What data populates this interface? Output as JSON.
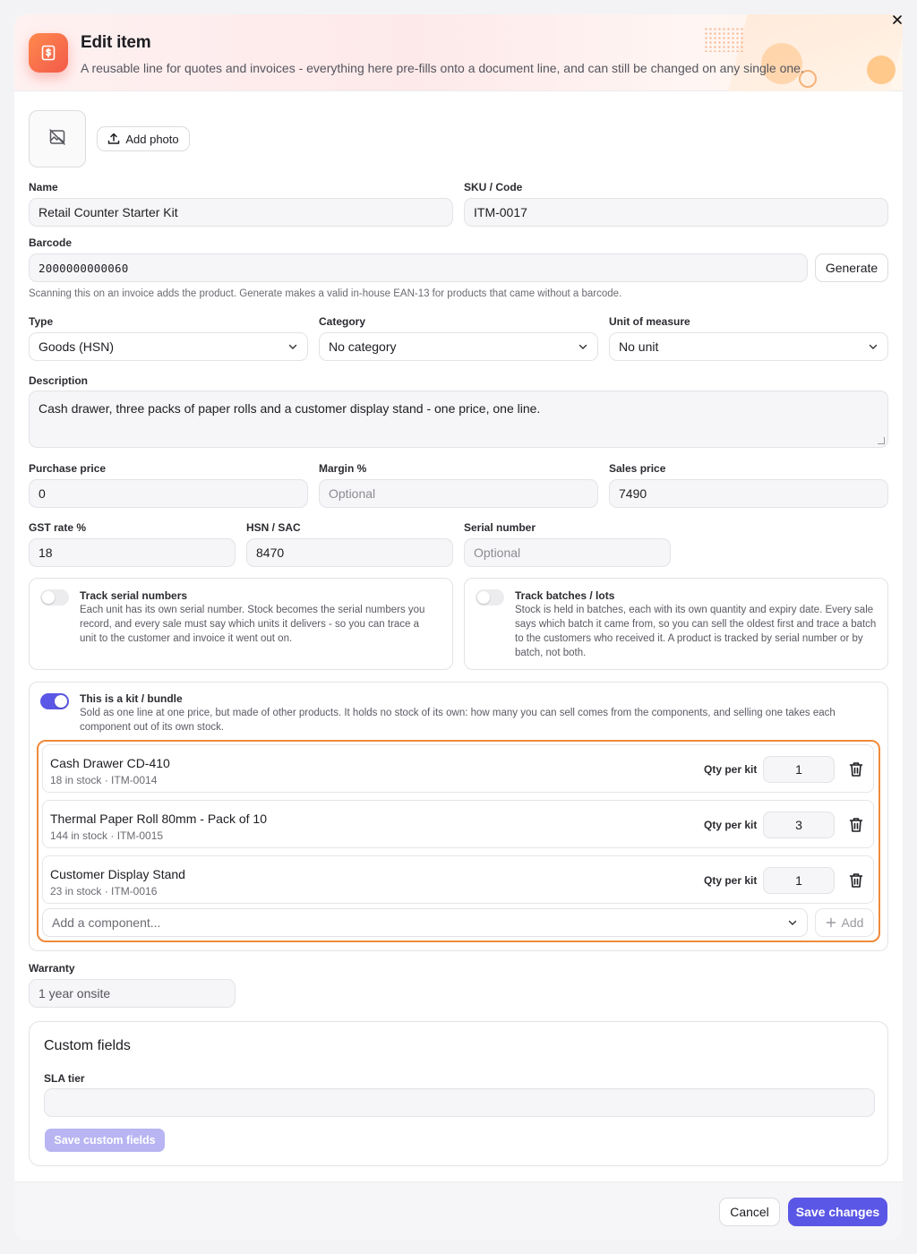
{
  "header": {
    "title": "Edit item",
    "subtitle": "A reusable line for quotes and invoices - everything here pre-fills onto a document line, and can still be changed on any single one.",
    "icon": "invoice-dollar-icon",
    "accent": "#f2594b"
  },
  "photo": {
    "add_label": "Add photo"
  },
  "fields": {
    "name": {
      "label": "Name",
      "value": "Retail Counter Starter Kit"
    },
    "sku": {
      "label": "SKU / Code",
      "value": "ITM-0017"
    },
    "barcode": {
      "label": "Barcode",
      "value": "2000000000060",
      "generate_label": "Generate",
      "helper": "Scanning this on an invoice adds the product. Generate makes a valid in-house EAN-13 for products that came without a barcode."
    },
    "type": {
      "label": "Type",
      "value": "Goods (HSN)"
    },
    "category": {
      "label": "Category",
      "value": "No category"
    },
    "unit": {
      "label": "Unit of measure",
      "value": "No unit"
    },
    "description": {
      "label": "Description",
      "value": "Cash drawer, three packs of paper rolls and a customer display stand - one price, one line."
    },
    "purchase_price": {
      "label": "Purchase price",
      "value": "0"
    },
    "margin": {
      "label": "Margin %",
      "placeholder": "Optional"
    },
    "sales_price": {
      "label": "Sales price",
      "value": "7490"
    },
    "gst": {
      "label": "GST rate %",
      "value": "18"
    },
    "hsn": {
      "label": "HSN / SAC",
      "value": "8470"
    },
    "serial": {
      "label": "Serial number",
      "placeholder": "Optional"
    },
    "warranty": {
      "label": "Warranty",
      "value": "1 year onsite"
    }
  },
  "tracking": {
    "serial": {
      "title": "Track serial numbers",
      "text": "Each unit has its own serial number. Stock becomes the serial numbers you record, and every sale must say which units it delivers - so you can trace a unit to the customer and invoice it went out on.",
      "enabled": false
    },
    "batches": {
      "title": "Track batches / lots",
      "text": "Stock is held in batches, each with its own quantity and expiry date. Every sale says which batch it came from, so you can sell the oldest first and trace a batch to the customers who received it. A product is tracked by serial number or by batch, not both.",
      "enabled": false
    }
  },
  "kit": {
    "title": "This is a kit / bundle",
    "text": "Sold as one line at one price, but made of other products. It holds no stock of its own: how many you can sell comes from the components, and selling one takes each component out of its own stock.",
    "enabled": true,
    "qty_label": "Qty per kit",
    "components": [
      {
        "name": "Cash Drawer CD-410",
        "meta": "18 in stock · ITM-0014",
        "qty": "1"
      },
      {
        "name": "Thermal Paper Roll 80mm - Pack of 10",
        "meta": "144 in stock · ITM-0015",
        "qty": "3"
      },
      {
        "name": "Customer Display Stand",
        "meta": "23 in stock · ITM-0016",
        "qty": "1"
      }
    ],
    "add_placeholder": "Add a component...",
    "add_label": "Add",
    "highlight_color": "#f08a3c"
  },
  "custom_fields": {
    "title": "Custom fields",
    "sla_label": "SLA tier",
    "sla_value": "",
    "save_label": "Save custom fields"
  },
  "footer": {
    "cancel_label": "Cancel",
    "save_label": "Save changes",
    "primary_color": "#5b57e6"
  }
}
